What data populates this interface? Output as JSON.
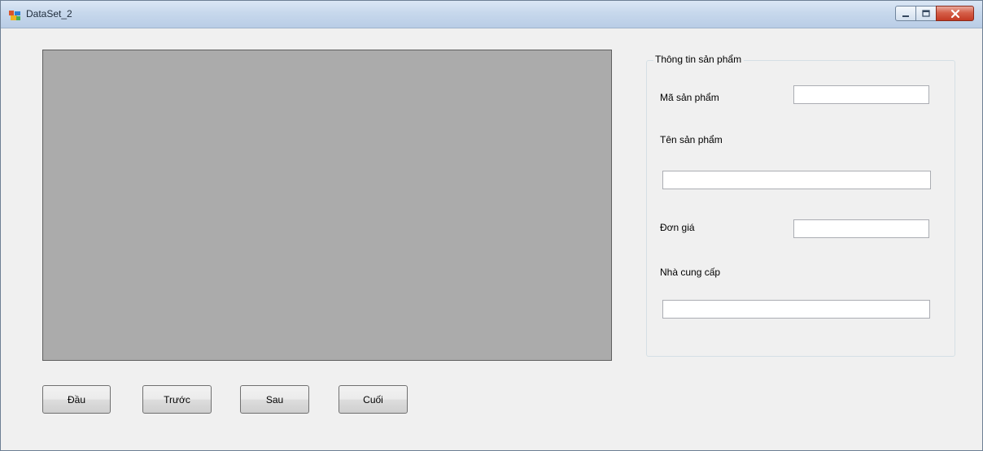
{
  "window": {
    "title": "DataSet_2",
    "controls": {
      "minimize": "minimize",
      "maximize": "maximize",
      "close": "close"
    }
  },
  "grid": {
    "rows": []
  },
  "product_info": {
    "group_title": "Thông tin sản phẩm",
    "product_code_label": "Mã sản phẩm",
    "product_code_value": "",
    "product_name_label": "Tên sản phẩm",
    "product_name_value": "",
    "unit_price_label": "Đơn giá",
    "unit_price_value": "",
    "supplier_label": "Nhà cung cấp",
    "supplier_value": ""
  },
  "navigation": {
    "first": "Đầu",
    "previous": "Trước",
    "next": "Sau",
    "last": "Cuối"
  },
  "colors": {
    "grid_background": "#ababab",
    "form_background": "#f0f0f0",
    "close_button": "#c43a24"
  }
}
